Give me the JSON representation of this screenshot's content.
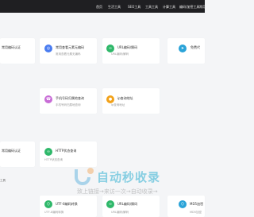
{
  "topnav": {
    "items": [
      "首页",
      "生活工具",
      "SEO工具",
      "工具工具",
      "计算工具",
      "编码/加密工具",
      "常用"
    ]
  },
  "cards": [
    {
      "title": "常用编码认证",
      "desc": "",
      "icon": "shield-icon",
      "color": "#ffffff"
    },
    {
      "title": "常用查看元素无编码",
      "desc": "常用查看元素无编码",
      "icon": "globe-icon",
      "color": "#4a7cf0"
    },
    {
      "title": "URL编码/解码",
      "desc": "URL编码/解码",
      "icon": "link-icon",
      "color": "#2fb86a"
    },
    {
      "title": "免费代",
      "desc": "",
      "icon": "send-icon",
      "color": "#2aa3d8"
    },
    {
      "title": "手机号码归属地查询",
      "desc": "手机号码归属地查询",
      "icon": "phone-icon",
      "color": "#c86cd6"
    },
    {
      "title": "ip查询地址",
      "desc": "ip查询地址",
      "icon": "location-icon",
      "color": "#f2a21a"
    },
    {
      "title": "常用编码认证",
      "desc": "",
      "icon": "shield-icon",
      "color": "#ffffff"
    },
    {
      "title": "HTTP状态查询",
      "desc": "HTTP状态查询",
      "icon": "link-icon",
      "color": "#2fb86a"
    },
    {
      "title": "UTF-8编码转换",
      "desc": "UTF-8编码转换",
      "icon": "code-icon",
      "color": "#2fb86a"
    },
    {
      "title": "URL编码/解码",
      "desc": "URL编码/解码",
      "icon": "link-icon",
      "color": "#2fb86a"
    },
    {
      "title": "MD5加密",
      "desc": "MD5加密",
      "icon": "code-icon",
      "color": "#2aa3d8"
    }
  ],
  "section": {
    "label": "工具"
  },
  "watermark": {
    "main": "自动秒收录",
    "sub": "致上链接→来访一次→自动收录→"
  }
}
